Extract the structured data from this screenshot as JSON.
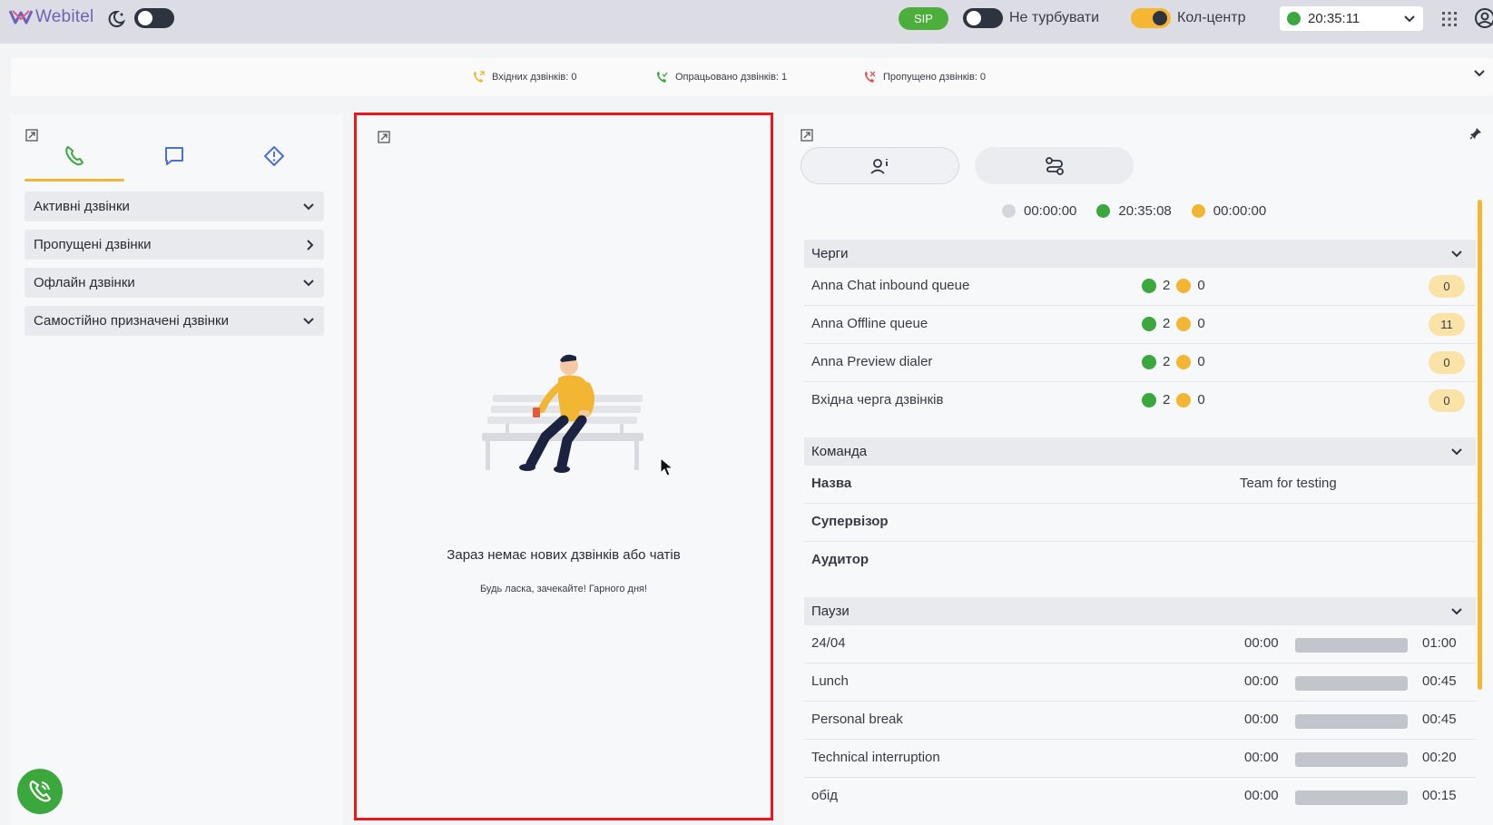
{
  "header": {
    "logo_text": "Webitel",
    "sip_label": "SIP",
    "dnd_label": "Не турбувати",
    "callcenter_label": "Кол-центр",
    "status_time": "20:35:11",
    "colors": {
      "accent": "#f2b632",
      "online": "#3aa83d",
      "highlight_border": "#e8181b"
    }
  },
  "stats": {
    "incoming": "Вхідних дзвінків: 0",
    "processed": "Опрацьовано дзвінків: 1",
    "missed": "Пропущено дзвінків: 0"
  },
  "left": {
    "tabs": [
      {
        "icon": "phone-icon",
        "active": true
      },
      {
        "icon": "chat-icon",
        "active": false
      },
      {
        "icon": "alert-diamond-icon",
        "active": false
      }
    ],
    "sections": [
      {
        "label": "Активні дзвінки",
        "expanded": true
      },
      {
        "label": "Пропущені дзвінки",
        "expanded": false
      },
      {
        "label": "Офлайн дзвінки",
        "expanded": true
      },
      {
        "label": "Самостійно призначені дзвінки",
        "expanded": true
      }
    ]
  },
  "middle": {
    "empty_title": "Зараз немає нових дзвінків або чатів",
    "empty_subtitle": "Будь ласка, зачекайте! Гарного дня!"
  },
  "right": {
    "timers": [
      "00:00:00",
      "20:35:08",
      "00:00:00"
    ],
    "queues_title": "Черги",
    "queues": [
      {
        "name": "Anna Chat inbound queue",
        "green": "2",
        "yellow": "0",
        "badge": "0"
      },
      {
        "name": "Anna Offline queue",
        "green": "2",
        "yellow": "0",
        "badge": "11"
      },
      {
        "name": "Anna Preview dialer",
        "green": "2",
        "yellow": "0",
        "badge": "0"
      },
      {
        "name": "Вхідна черга дзвінків",
        "green": "2",
        "yellow": "0",
        "badge": "0"
      }
    ],
    "team_title": "Команда",
    "team": [
      {
        "key": "Назва",
        "value": "Team for testing"
      },
      {
        "key": "Супервізор",
        "value": ""
      },
      {
        "key": "Аудитор",
        "value": ""
      }
    ],
    "pauses_title": "Паузи",
    "pauses": [
      {
        "name": "24/04",
        "start": "00:00",
        "end": "01:00",
        "progress": 0
      },
      {
        "name": "Lunch",
        "start": "00:00",
        "end": "00:45",
        "progress": 0
      },
      {
        "name": "Personal break",
        "start": "00:00",
        "end": "00:45",
        "progress": 0
      },
      {
        "name": "Technical interruption",
        "start": "00:00",
        "end": "00:20",
        "progress": 0
      },
      {
        "name": "обід",
        "start": "00:00",
        "end": "00:15",
        "progress": 0
      }
    ]
  }
}
